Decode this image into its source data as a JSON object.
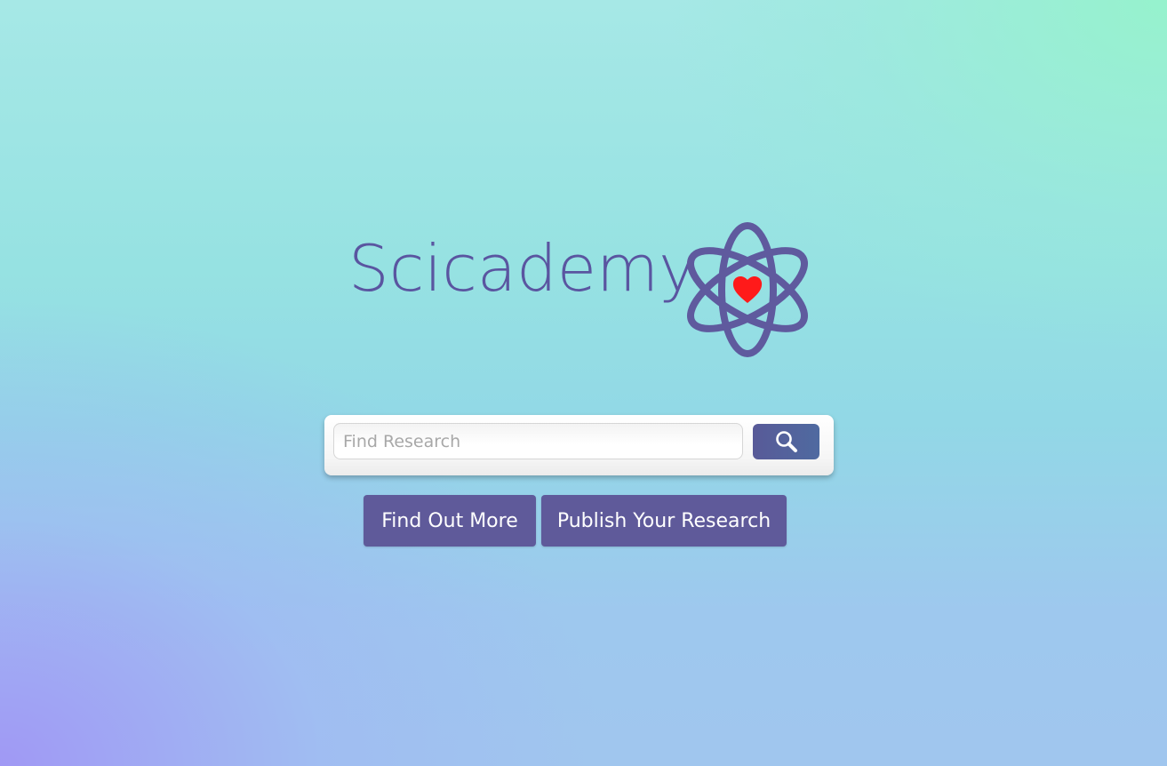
{
  "brand": {
    "name": "Scicademy",
    "logo_icon": "atom-heart-icon"
  },
  "search": {
    "placeholder": "Find Research",
    "value": "",
    "button_icon": "search-icon"
  },
  "actions": {
    "find_out_more": "Find Out More",
    "publish": "Publish Your Research"
  },
  "colors": {
    "brand_purple": "#5f5a9a",
    "heart_red": "#ff1a1a",
    "background_top": "#a6e8e6",
    "background_bottom_left": "#a096f5"
  }
}
